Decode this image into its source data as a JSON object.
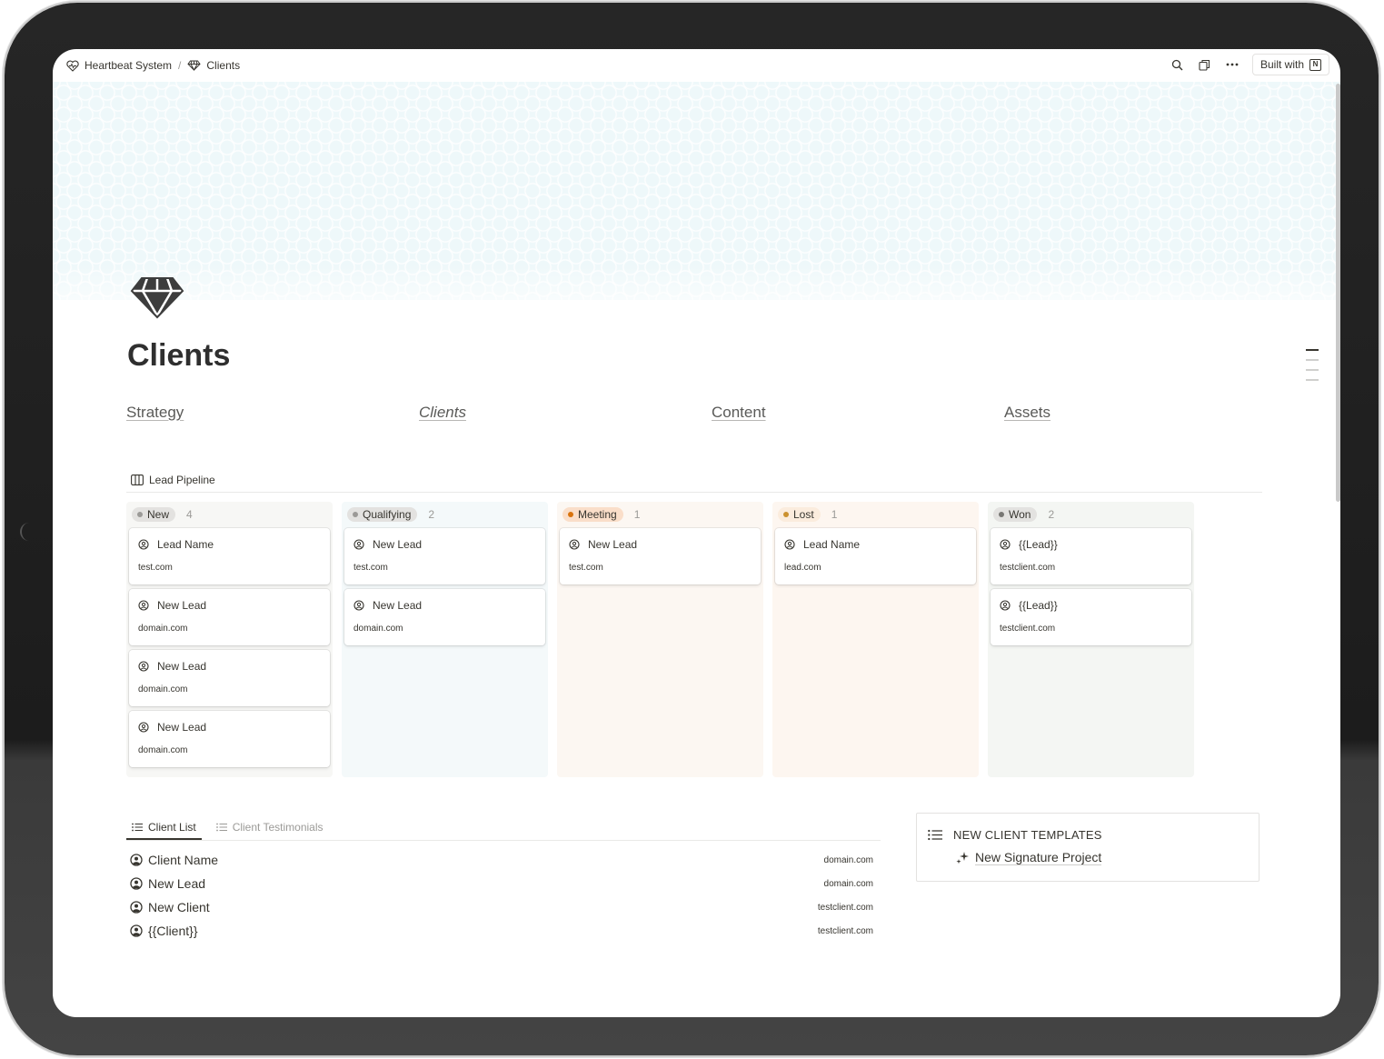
{
  "breadcrumb": {
    "items": [
      {
        "label": "Heartbeat System",
        "icon": "heartbeat-icon"
      },
      {
        "label": "Clients",
        "icon": "gem-icon"
      }
    ],
    "separator": "/"
  },
  "topbar": {
    "built_with_label": "Built with",
    "icons": [
      "search-icon",
      "duplicate-icon",
      "more-icon",
      "notion-logo-icon"
    ]
  },
  "page": {
    "icon": "gem-icon",
    "title": "Clients"
  },
  "nav_links": [
    {
      "label": "Strategy",
      "style": "normal"
    },
    {
      "label": "Clients",
      "style": "italic"
    },
    {
      "label": "Content",
      "style": "normal"
    },
    {
      "label": "Assets",
      "style": "normal"
    }
  ],
  "board": {
    "title": "Lead Pipeline",
    "icon": "board-view-icon",
    "columns": [
      {
        "label": "New",
        "count": "4",
        "pill_color": "#e3e2e0",
        "dot_color": "#9b9a97",
        "bg_color": "#f7f7f5",
        "cards": [
          {
            "title": "Lead Name",
            "domain": "test.com"
          },
          {
            "title": "New Lead",
            "domain": "domain.com"
          },
          {
            "title": "New Lead",
            "domain": "domain.com"
          },
          {
            "title": "New Lead",
            "domain": "domain.com"
          }
        ]
      },
      {
        "label": "Qualifying",
        "count": "2",
        "pill_color": "#e3e2e0",
        "dot_color": "#9b9a97",
        "bg_color": "#f4f9fa",
        "cards": [
          {
            "title": "New Lead",
            "domain": "test.com"
          },
          {
            "title": "New Lead",
            "domain": "domain.com"
          }
        ]
      },
      {
        "label": "Meeting",
        "count": "1",
        "pill_color": "#fadec9",
        "dot_color": "#d9730d",
        "bg_color": "#fcf7f2",
        "cards": [
          {
            "title": "New Lead",
            "domain": "test.com"
          }
        ]
      },
      {
        "label": "Lost",
        "count": "1",
        "pill_color": "#fbecdd",
        "dot_color": "#cb912f",
        "bg_color": "#fdf6f0",
        "cards": [
          {
            "title": "Lead Name",
            "domain": "lead.com"
          }
        ]
      },
      {
        "label": "Won",
        "count": "2",
        "pill_color": "#e3e2e0",
        "dot_color": "#787774",
        "bg_color": "#f4f6f3",
        "cards": [
          {
            "title": "{{Lead}}",
            "domain": "testclient.com"
          },
          {
            "title": "{{Lead}}",
            "domain": "testclient.com"
          }
        ]
      }
    ]
  },
  "client_tabs": [
    {
      "label": "Client List",
      "active": true,
      "icon": "list-icon"
    },
    {
      "label": "Client Testimonials",
      "active": false,
      "icon": "list-icon"
    }
  ],
  "clients": [
    {
      "name": "Client Name",
      "domain": "domain.com"
    },
    {
      "name": "New Lead",
      "domain": "domain.com"
    },
    {
      "name": "New Client",
      "domain": "testclient.com"
    },
    {
      "name": "{{Client}}",
      "domain": "testclient.com"
    }
  ],
  "templates": {
    "heading": "NEW CLIENT TEMPLATES",
    "heading_icon": "list-icon",
    "item_label": "New Signature Project",
    "item_icon": "sparkle-icon"
  }
}
